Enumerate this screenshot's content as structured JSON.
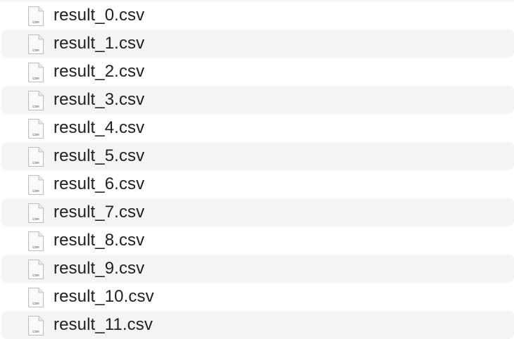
{
  "files": [
    {
      "name": "result_0.csv",
      "icon": "csv-file-icon",
      "icon_label": "CSV"
    },
    {
      "name": "result_1.csv",
      "icon": "csv-file-icon",
      "icon_label": "CSV"
    },
    {
      "name": "result_2.csv",
      "icon": "csv-file-icon",
      "icon_label": "CSV"
    },
    {
      "name": "result_3.csv",
      "icon": "csv-file-icon",
      "icon_label": "CSV"
    },
    {
      "name": "result_4.csv",
      "icon": "csv-file-icon",
      "icon_label": "CSV"
    },
    {
      "name": "result_5.csv",
      "icon": "csv-file-icon",
      "icon_label": "CSV"
    },
    {
      "name": "result_6.csv",
      "icon": "csv-file-icon",
      "icon_label": "CSV"
    },
    {
      "name": "result_7.csv",
      "icon": "csv-file-icon",
      "icon_label": "CSV"
    },
    {
      "name": "result_8.csv",
      "icon": "csv-file-icon",
      "icon_label": "CSV"
    },
    {
      "name": "result_9.csv",
      "icon": "csv-file-icon",
      "icon_label": "CSV"
    },
    {
      "name": "result_10.csv",
      "icon": "csv-file-icon",
      "icon_label": "CSV"
    },
    {
      "name": "result_11.csv",
      "icon": "csv-file-icon",
      "icon_label": "CSV"
    }
  ],
  "colors": {
    "row_alt_background": "#f4f4f4",
    "text": "#1f1f1f",
    "icon_fill": "#fbfbfb",
    "icon_stroke": "#bdbdbd"
  }
}
